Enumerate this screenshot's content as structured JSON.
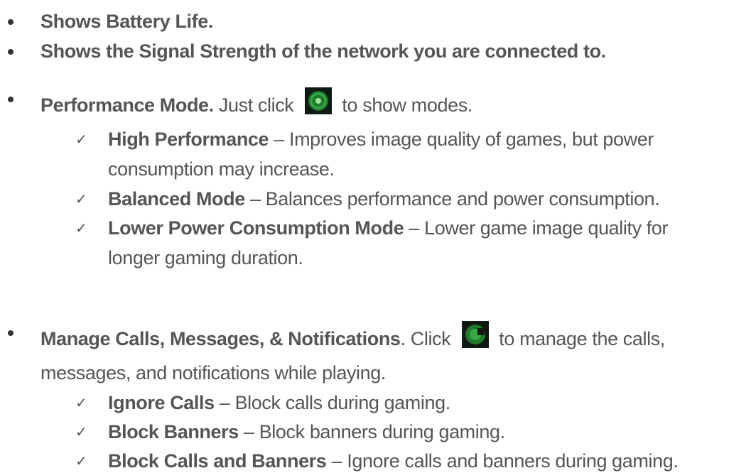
{
  "bullets": {
    "battery": "Shows Battery Life.",
    "signal": "Shows the Signal Strength of the network you are connected to.",
    "performance": {
      "title": "Performance Mode.",
      "text_before": " Just click",
      "icon": "razer-performance-icon",
      "text_after": "to show modes."
    },
    "calls": {
      "title": "Manage Calls, Messages, & Notifications",
      "text_before": ". Click",
      "icon": "razer-notifications-icon",
      "text_after": "to manage the calls,",
      "continuation": "messages, and notifications while playing."
    }
  },
  "performance_modes": [
    {
      "name": "High Performance",
      "desc": " – Improves image quality of games, but power",
      "desc2": "consumption may increase."
    },
    {
      "name": "Balanced Mode",
      "desc": " – Balances performance and power consumption."
    },
    {
      "name": "Lower Power Consumption Mode",
      "desc": " – Lower game image quality for",
      "desc2": "longer gaming duration."
    }
  ],
  "call_options": [
    {
      "name": "Ignore Calls",
      "desc": " – Block calls during gaming."
    },
    {
      "name": "Block Banners",
      "desc": " – Block banners during gaming."
    },
    {
      "name": "Block Calls and Banners",
      "desc": " – Ignore calls and banners during gaming."
    }
  ],
  "colors": {
    "text": "#555555",
    "icon_bg": "#0f1a12",
    "icon_accent": "#35a845"
  }
}
